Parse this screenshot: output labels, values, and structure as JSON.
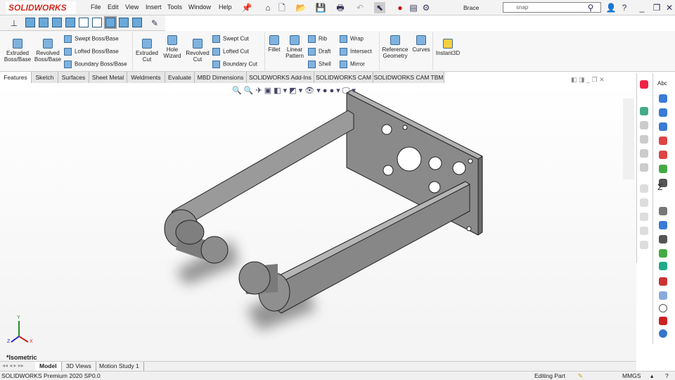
{
  "app": {
    "logo": "SOLIDWORKS",
    "document_title": "Brace"
  },
  "menu": [
    "File",
    "Edit",
    "View",
    "Insert",
    "Tools",
    "Window",
    "Help"
  ],
  "search": {
    "value": "snap"
  },
  "ribbon": {
    "large": [
      {
        "label": "Extruded Boss/Base"
      },
      {
        "label": "Revolved Boss/Base"
      },
      {
        "label": "Extruded Cut"
      },
      {
        "label": "Hole Wizard"
      },
      {
        "label": "Revolved Cut"
      },
      {
        "label": "Fillet"
      },
      {
        "label": "Linear Pattern"
      },
      {
        "label": "Reference Geometry"
      },
      {
        "label": "Curves"
      },
      {
        "label": "Instant3D"
      }
    ],
    "small": [
      "Swept Boss/Base",
      "Lofted Boss/Base",
      "Boundary Boss/Base",
      "Swept Cut",
      "Lofted Cut",
      "Boundary Cut",
      "Rib",
      "Draft",
      "Shell",
      "Wrap",
      "Intersect",
      "Mirror"
    ]
  },
  "tabs": [
    "Features",
    "Sketch",
    "Surfaces",
    "Sheet Metal",
    "Weldments",
    "Evaluate",
    "MBD Dimensions",
    "SOLIDWORKS Add-Ins",
    "SOLIDWORKS CAM",
    "SOLIDWORKS CAM TBM"
  ],
  "active_tab": "Features",
  "viewport": {
    "view_name": "*Isometric",
    "triad": {
      "x": "X",
      "y": "Y",
      "z": "Z"
    }
  },
  "bottom_tabs": [
    "Model",
    "3D Views",
    "Motion Study 1"
  ],
  "status": {
    "version": "SOLIDWORKS Premium 2020 SP0.0",
    "mode": "Editing Part",
    "units": "MMGS"
  }
}
